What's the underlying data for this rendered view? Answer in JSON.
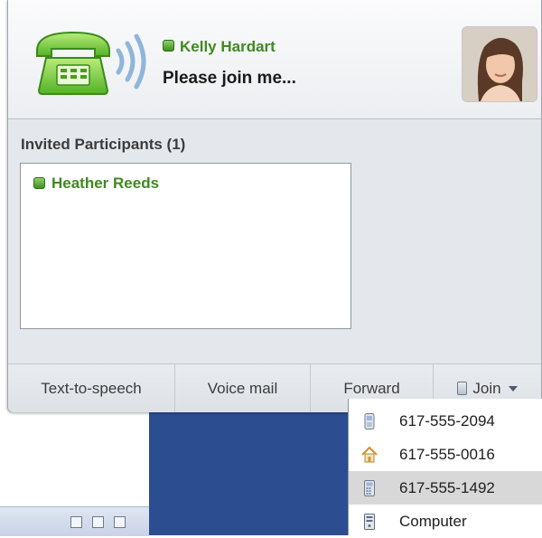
{
  "notification": {
    "caller_name": "Kelly Hardart",
    "message": "Please join me...",
    "status_color": "#3e8f22"
  },
  "participants": {
    "title": "Invited Participants (1)",
    "items": [
      {
        "name": "Heather Reeds"
      }
    ]
  },
  "toolbar": {
    "text_to_speech": "Text-to-speech",
    "voice_mail": "Voice mail",
    "forward": "Forward",
    "join": "Join"
  },
  "join_menu": {
    "items": [
      {
        "label": "617-555-2094",
        "icon": "mobile-phone-icon",
        "selected": false
      },
      {
        "label": "617-555-0016",
        "icon": "home-icon",
        "selected": false
      },
      {
        "label": "617-555-1492",
        "icon": "office-phone-icon",
        "selected": true
      },
      {
        "label": "Computer",
        "icon": "computer-icon",
        "selected": false
      }
    ]
  },
  "colors": {
    "desktop_blue": "#2b4e91",
    "presence_green": "#3f8a1f",
    "selected_item": "#d8d8d8"
  }
}
